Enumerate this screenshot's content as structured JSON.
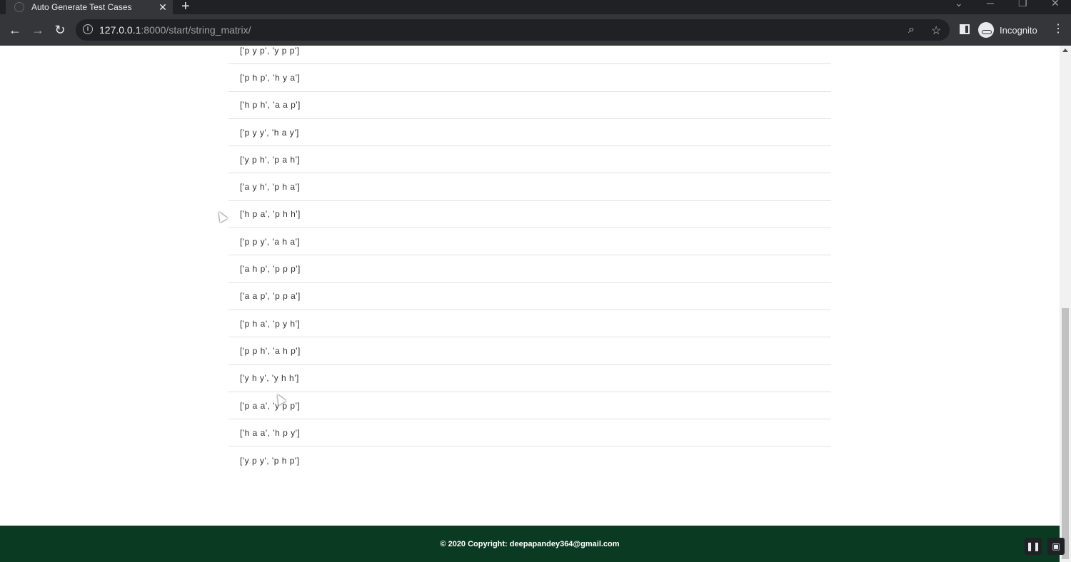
{
  "browser": {
    "tab_title": "Auto Generate Test Cases",
    "url_host": "127.0.0.1",
    "url_rest": ":8000/start/string_matrix/",
    "profile_label": "Incognito"
  },
  "list": {
    "rows": [
      "['p y p', 'y p p']",
      "['p h p', 'h y a']",
      "['h p h', 'a a p']",
      "['p y y', 'h a y']",
      "['y p h', 'p a h']",
      "['a y h', 'p h a']",
      "['h p a', 'p h h']",
      "['p p y', 'a h a']",
      "['a h p', 'p p p']",
      "['a a p', 'p p a']",
      "['p h a', 'p y h']",
      "['p p h', 'a h p']",
      "['y h y', 'y h h']",
      "['p a a', 'y p p']",
      "['h a a', 'h p y']",
      "['y p y', 'p h p']"
    ]
  },
  "footer": {
    "text": "© 2020 Copyright: deepapandey364@gmail.com"
  },
  "colors": {
    "footer_bg": "#0b3a23",
    "chrome_dark": "#202124",
    "chrome_toolbar": "#35363a"
  },
  "icons": [
    "globe-icon",
    "close-icon",
    "plus-icon",
    "back-icon",
    "forward-icon",
    "reload-icon",
    "info-icon",
    "zoom-icon",
    "star-icon",
    "side-panel-icon",
    "incognito-icon",
    "menu-icon",
    "pause-icon",
    "screen-share-icon"
  ]
}
